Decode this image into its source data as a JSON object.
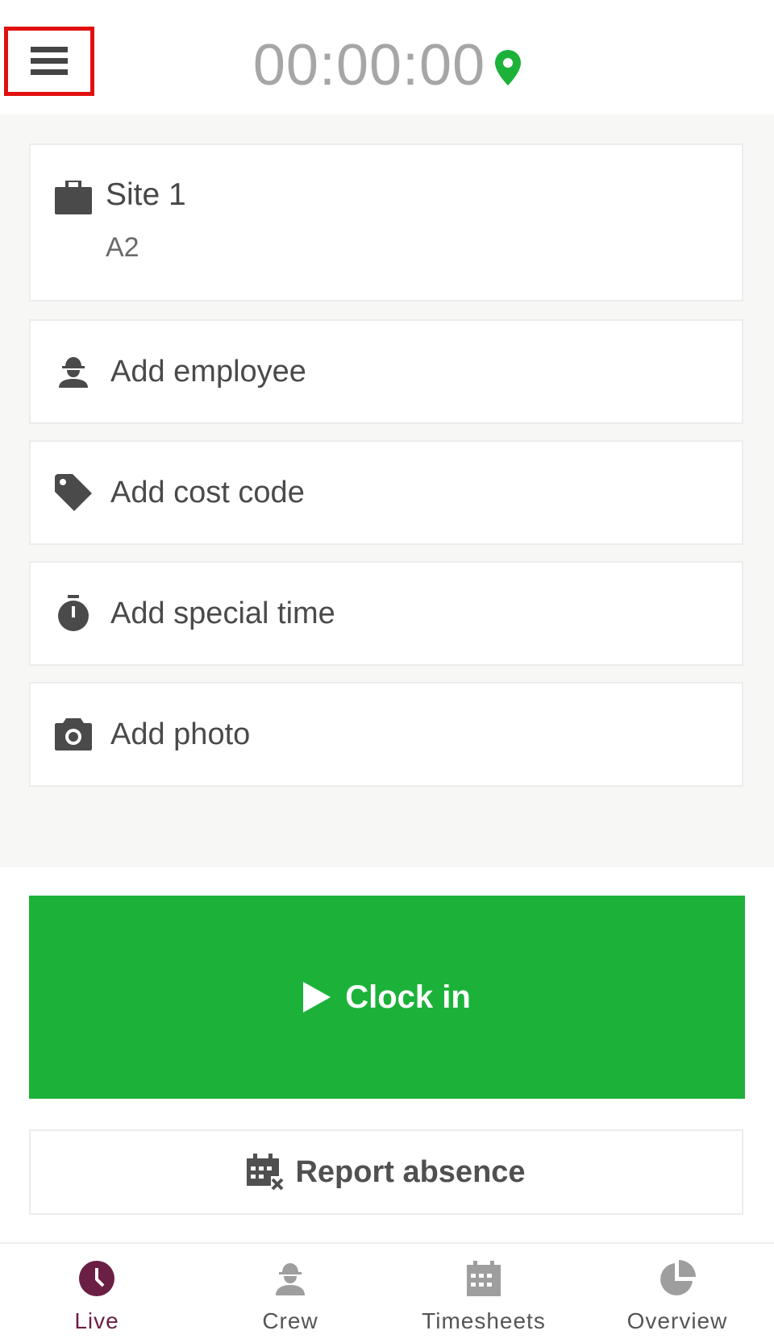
{
  "header": {
    "menu_icon": "hamburger-menu-icon",
    "timer": "00:00:00",
    "location_icon": "location-pin-icon"
  },
  "site": {
    "icon": "briefcase-icon",
    "title": "Site 1",
    "subtitle": "A2"
  },
  "actions": [
    {
      "icon": "worker-icon",
      "label": "Add employee"
    },
    {
      "icon": "tag-icon",
      "label": "Add cost code"
    },
    {
      "icon": "stopwatch-icon",
      "label": "Add special time"
    },
    {
      "icon": "camera-icon",
      "label": "Add photo"
    }
  ],
  "clock_in": {
    "icon": "play-icon",
    "label": "Clock in"
  },
  "report_absence": {
    "icon": "calendar-remove-icon",
    "label": "Report absence"
  },
  "tabs": [
    {
      "icon": "clock-icon",
      "label": "Live",
      "active": true
    },
    {
      "icon": "worker-icon",
      "label": "Crew",
      "active": false
    },
    {
      "icon": "calendar-icon",
      "label": "Timesheets",
      "active": false
    },
    {
      "icon": "pie-chart-icon",
      "label": "Overview",
      "active": false
    }
  ],
  "colors": {
    "accent_green": "#1cb239",
    "active_tab": "#6b1f45",
    "highlight_box": "#e01010",
    "icon_gray": "#4a4a4a"
  }
}
